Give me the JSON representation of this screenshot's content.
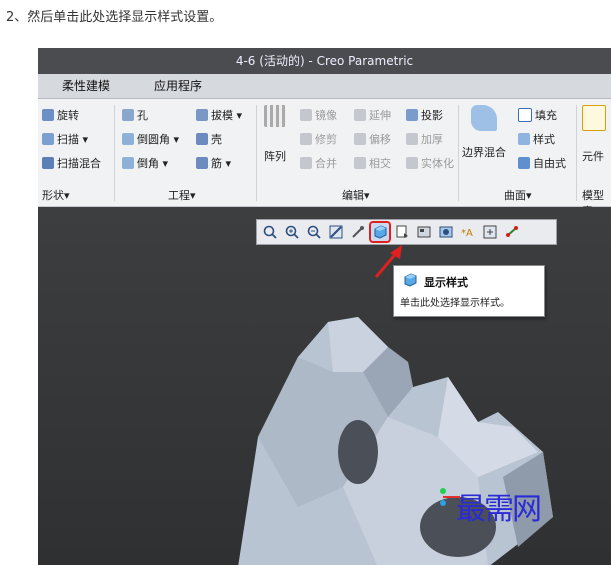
{
  "step_text": "2、然后单击此处选择显示样式设置。",
  "window": {
    "title": "4-6 (活动的) - Creo Parametric",
    "tabs": [
      "柔性建模",
      "应用程序"
    ]
  },
  "ribbon": {
    "shape": {
      "items": [
        "旋转",
        "扫描 ▾",
        "扫描混合"
      ],
      "group": "形状▾"
    },
    "engineering": {
      "items": [
        "孔",
        "拔模 ▾",
        "倒圆角 ▾",
        "壳",
        "倒角 ▾",
        "筋 ▾"
      ],
      "group": "工程▾"
    },
    "edit": {
      "array": "阵列",
      "items": [
        "镜像",
        "延伸",
        "投影",
        "修剪",
        "偏移",
        "加厚",
        "合并",
        "相交",
        "实体化"
      ],
      "group": "编辑▾"
    },
    "surface": {
      "items": [
        "边界混合",
        "填充",
        "样式",
        "自由式"
      ],
      "group": "曲面▾"
    },
    "model_intent": {
      "items": [
        "元件"
      ],
      "group": "模型意"
    }
  },
  "tooltip": {
    "title": "显示样式",
    "body": "单击此处选择显示样式。"
  },
  "watermark": "最需网",
  "colors": {
    "highlight": "#e02020",
    "watermark": "#2b2bd6"
  },
  "toolbar_icons": [
    "zoom-fit-icon",
    "zoom-in-icon",
    "zoom-out-icon",
    "repaint-icon",
    "reorient-icon",
    "display-style-icon",
    "saved-views-icon",
    "view-manager-icon",
    "perspective-icon",
    "datum-display-icon",
    "spin-center-icon",
    "annotation-icon"
  ]
}
